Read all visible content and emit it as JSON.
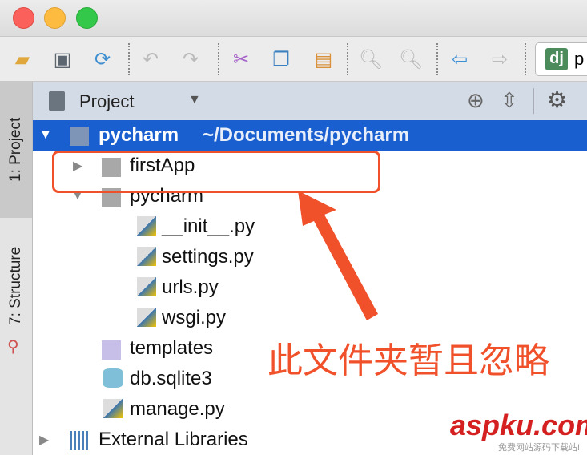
{
  "toolbar": {
    "run_config_partial": "p",
    "icons": [
      "open-folder-icon",
      "save-icon",
      "sync-icon",
      "undo-icon",
      "redo-icon",
      "cut-icon",
      "copy-icon",
      "paste-icon",
      "find-icon",
      "replace-icon",
      "back-icon",
      "forward-icon"
    ]
  },
  "side_tabs": {
    "project": "1: Project",
    "structure": "7: Structure"
  },
  "panel": {
    "title": "Project"
  },
  "tree": {
    "root_name": "pycharm",
    "root_path": "~/Documents/pycharm",
    "items": [
      "firstApp",
      "pycharm",
      "__init__.py",
      "settings.py",
      "urls.py",
      "wsgi.py",
      "templates",
      "db.sqlite3",
      "manage.py",
      "External Libraries"
    ]
  },
  "annotation": {
    "text": "此文件夹暂且忽略"
  },
  "watermark": {
    "brand": "aspku.com",
    "tagline": "免费网站源码下载站!"
  },
  "colors": {
    "selection": "#1a5fcf",
    "annotation": "#f0502a"
  }
}
